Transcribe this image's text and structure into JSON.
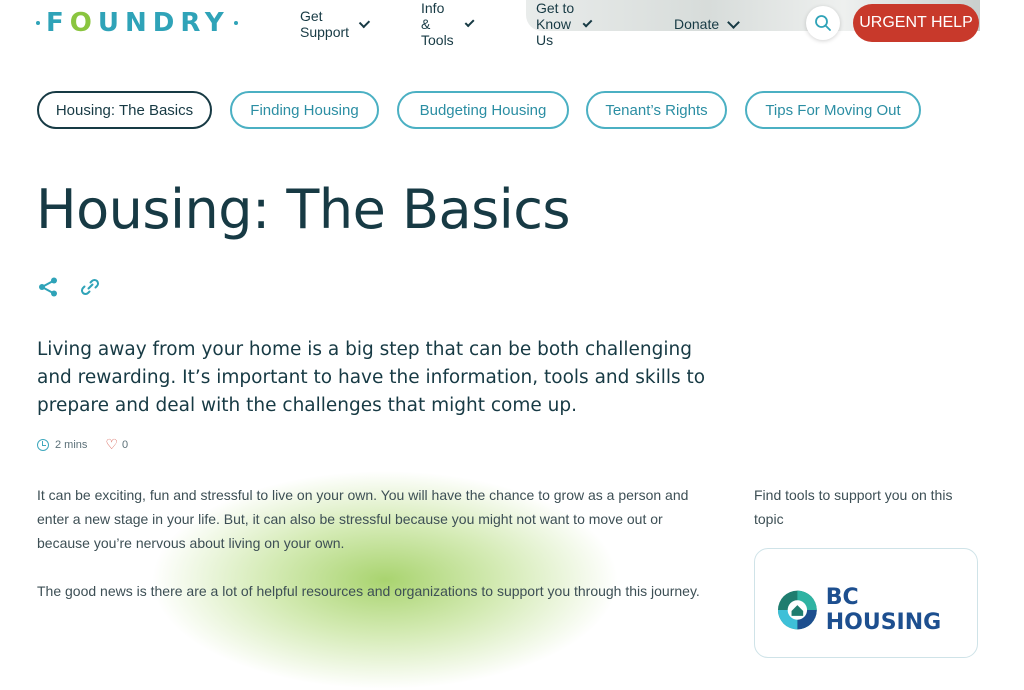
{
  "header": {
    "logo_text": "FOUNDRY",
    "nav": [
      {
        "label": "Get Support"
      },
      {
        "label": "Info & Tools"
      },
      {
        "label": "Get to Know Us"
      },
      {
        "label": "Donate"
      }
    ],
    "urgent_label": "URGENT HELP"
  },
  "pills": [
    {
      "label": "Housing: The Basics",
      "active": true
    },
    {
      "label": "Finding Housing",
      "active": false
    },
    {
      "label": "Budgeting Housing",
      "active": false
    },
    {
      "label": "Tenant’s Rights",
      "active": false
    },
    {
      "label": "Tips For Moving Out",
      "active": false
    }
  ],
  "article": {
    "title": "Housing: The Basics",
    "intro": "Living away from your home is a big step that can be both challenging and rewarding. It’s important to have the information, tools and skills to prepare and deal with the challenges that might come up.",
    "read_time": "2 mins",
    "likes": "0",
    "paragraphs": [
      "It can be exciting, fun and stressful to live on your own. You will have the chance to grow as a person and enter a new stage in your life. But, it can also be stressful because you might not want to move out or because you’re nervous about living on your own.",
      "The good news is there are a lot of helpful resources and organizations to support you through this journey."
    ]
  },
  "aside": {
    "label": "Find tools to support you on this topic",
    "tool_name": "BC HOUSING"
  },
  "colors": {
    "primary_dark": "#173a44",
    "teal": "#2fa3b8",
    "green": "#8ac53f",
    "urgent_red": "#c8392b"
  },
  "icons": [
    "search-icon",
    "share-icon",
    "link-icon",
    "clock-icon",
    "heart-icon",
    "chevron-down-icon"
  ]
}
